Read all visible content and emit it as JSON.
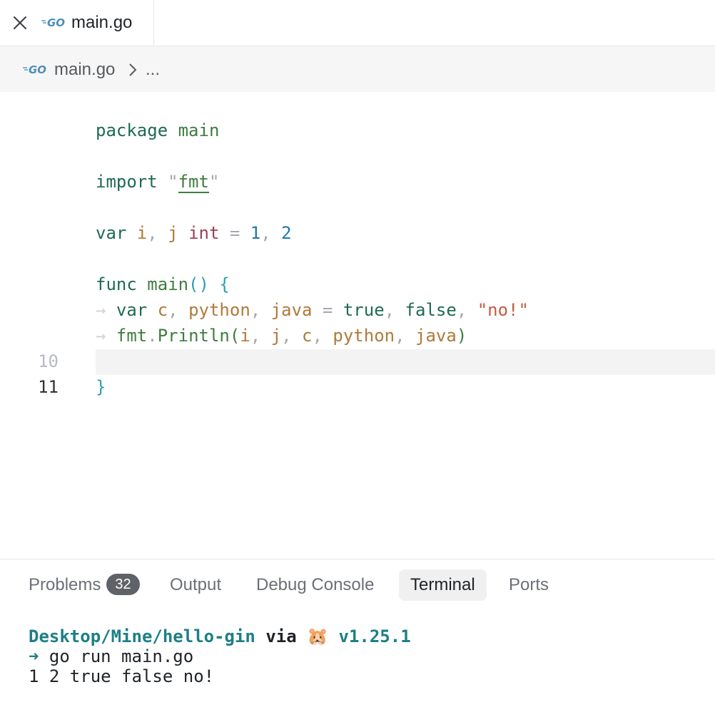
{
  "tab": {
    "title": "main.go",
    "close_icon": "close-icon",
    "file_icon": "go-file-icon"
  },
  "breadcrumb": {
    "file": "main.go",
    "more": "...",
    "chevron_icon": "chevron-right-icon"
  },
  "editor": {
    "line_numbers": [
      "10",
      "11"
    ],
    "code": {
      "l1_kw": "package",
      "l1_name": "main",
      "l3_kw": "import",
      "l3_q1": "\"",
      "l3_pkg": "fmt",
      "l3_q2": "\"",
      "l5_kw": "var",
      "l5_i": "i",
      "l5_comma1": ",",
      "l5_j": "j",
      "l5_type": "int",
      "l5_eq": "=",
      "l5_n1": "1",
      "l5_comma2": ",",
      "l5_n2": "2",
      "l7_kw": "func",
      "l7_name": "main",
      "l7_parens": "()",
      "l7_brace": "{",
      "indent_arrow": "→",
      "l8_kw": "var",
      "l8_c": "c",
      "l8_python": "python",
      "l8_java": "java",
      "l8_eq": "=",
      "l8_true": "true",
      "l8_false": "false",
      "l8_str": "\"no!\"",
      "l9_pkg": "fmt",
      "l9_dot": ".",
      "l9_fn": "Println",
      "l9_open": "(",
      "l9_i": "i",
      "l9_j": "j",
      "l9_c": "c",
      "l9_python": "python",
      "l9_java": "java",
      "l9_close": ")",
      "l10_brace": "}",
      "comma": ","
    }
  },
  "panel": {
    "tabs": [
      {
        "label": "Problems",
        "badge": "32"
      },
      {
        "label": "Output"
      },
      {
        "label": "Debug Console"
      },
      {
        "label": "Terminal"
      },
      {
        "label": "Ports"
      }
    ],
    "active_tab": "Terminal",
    "terminal": {
      "path": "Desktop/Mine/hello-gin",
      "via": "via",
      "gopher": "🐹",
      "version": "v1.25.1",
      "prompt_arrow": "➜",
      "command": "go run main.go",
      "output": "1 2 true false no!"
    }
  },
  "colors": {
    "keyword": "#1e6b52",
    "identifier": "#b07a3a",
    "type": "#9c3f56",
    "number": "#1e7aa0",
    "string": "#c55b3f",
    "terminal_accent": "#1d7f86",
    "badge_bg": "#5f6368"
  }
}
